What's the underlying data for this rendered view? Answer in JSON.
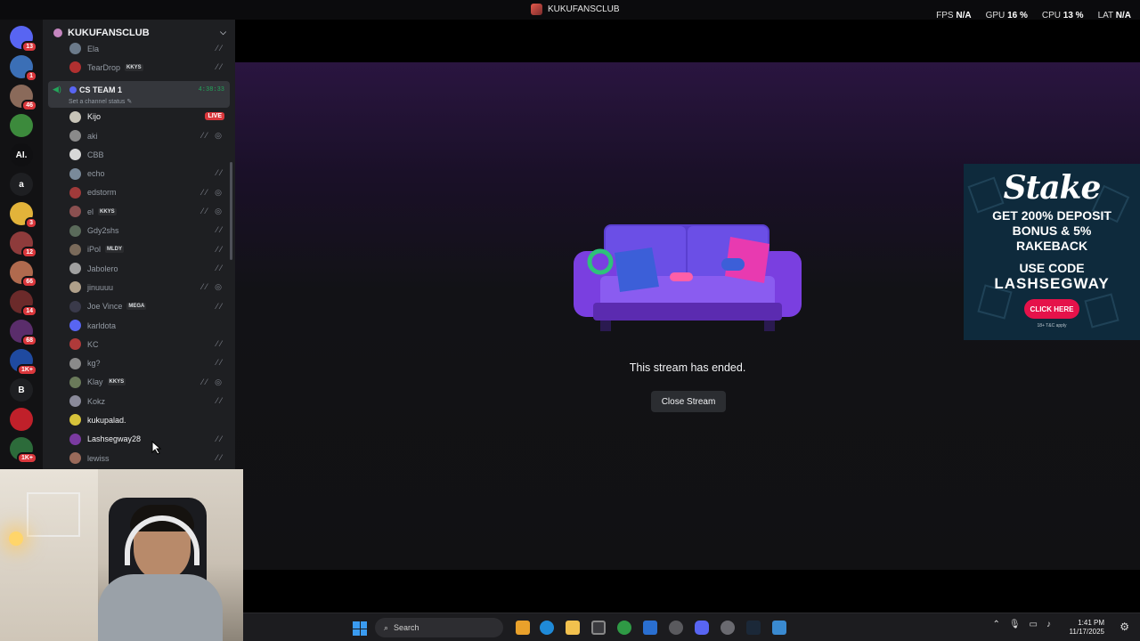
{
  "window": {
    "title": "KUKUFANSCLUB"
  },
  "perf": [
    {
      "label": "FPS",
      "value": "N/A"
    },
    {
      "label": "GPU",
      "value": "16 %"
    },
    {
      "label": "CPU",
      "value": "13 %"
    },
    {
      "label": "LAT",
      "value": "N/A"
    }
  ],
  "guilds": [
    {
      "label": "",
      "color": "#5865f2",
      "badge": "13",
      "icon": "discord-home-icon"
    },
    {
      "label": "",
      "color": "#3b6fb6",
      "badge": "1",
      "icon": "server-icon"
    },
    {
      "label": "",
      "color": "#8a6a5a",
      "badge": "46",
      "icon": "server-icon"
    },
    {
      "label": "",
      "color": "#3c8a3c",
      "badge": "",
      "icon": "server-icon"
    },
    {
      "label": "AI.",
      "color": "#101012",
      "badge": "",
      "icon": "server-icon"
    },
    {
      "label": "a",
      "color": "#1e1f22",
      "badge": "",
      "icon": "server-icon"
    },
    {
      "label": "",
      "color": "#e2b33a",
      "badge": "3",
      "icon": "server-icon"
    },
    {
      "label": "",
      "color": "#8e3b3b",
      "badge": "12",
      "icon": "server-icon"
    },
    {
      "label": "",
      "color": "#b06a4e",
      "badge": "66",
      "icon": "server-icon"
    },
    {
      "label": "",
      "color": "#6b2a2a",
      "badge": "14",
      "icon": "server-icon"
    },
    {
      "label": "",
      "color": "#5a2d6b",
      "badge": "68",
      "icon": "server-icon"
    },
    {
      "label": "",
      "color": "#1f4aa0",
      "badge": "1K+",
      "icon": "server-icon"
    },
    {
      "label": "B",
      "color": "#1e1f22",
      "badge": "",
      "icon": "server-icon"
    },
    {
      "label": "",
      "color": "#c0202a",
      "badge": "",
      "icon": "server-icon"
    },
    {
      "label": "",
      "color": "#2c6b3a",
      "badge": "1K+",
      "icon": "server-icon"
    }
  ],
  "server": {
    "name": "KUKUFANSCLUB"
  },
  "users_above": [
    {
      "name": "Ela",
      "color": "#6b7a8a",
      "tag": "",
      "icons": "⁄⁄"
    },
    {
      "name": "TearDrop",
      "color": "#b03030",
      "tag": "KKYS",
      "icons": "⁄⁄"
    }
  ],
  "voice_channel": {
    "name": "CS TEAM 1",
    "timer": "4:38:33",
    "status": "Set a channel status"
  },
  "users": [
    {
      "name": "Kijo",
      "color": "#c8c4b8",
      "tag": "",
      "icons": "",
      "live": "LIVE",
      "active": true
    },
    {
      "name": "aki",
      "color": "#8a8a8a",
      "tag": "",
      "icons": "⁄⁄ ◎",
      "live": ""
    },
    {
      "name": "CBB",
      "color": "#d8d8d8",
      "tag": "",
      "icons": "",
      "live": ""
    },
    {
      "name": "echo",
      "color": "#7a8a9a",
      "tag": "",
      "icons": "⁄⁄",
      "live": ""
    },
    {
      "name": "edstorm",
      "color": "#a03a3a",
      "tag": "",
      "icons": "⁄⁄ ◎",
      "live": ""
    },
    {
      "name": "el",
      "color": "#8a5050",
      "tag": "KKYS",
      "icons": "⁄⁄ ◎",
      "live": ""
    },
    {
      "name": "Gdy2shs",
      "color": "#5a6a5a",
      "tag": "",
      "icons": "⁄⁄",
      "live": ""
    },
    {
      "name": "iPol",
      "color": "#7a6a5a",
      "tag": "MLDY",
      "icons": "⁄⁄",
      "live": ""
    },
    {
      "name": "Jabolero",
      "color": "#a0a0a0",
      "tag": "",
      "icons": "⁄⁄",
      "live": ""
    },
    {
      "name": "jinuuuu",
      "color": "#b0a08a",
      "tag": "",
      "icons": "⁄⁄ ◎",
      "live": ""
    },
    {
      "name": "Joe Vince",
      "color": "#3a3a4a",
      "tag": "MEGA",
      "icons": "⁄⁄",
      "live": ""
    },
    {
      "name": "karldota",
      "color": "#5865f2",
      "tag": "",
      "icons": "",
      "live": ""
    },
    {
      "name": "KC",
      "color": "#b03a3a",
      "tag": "",
      "icons": "⁄⁄",
      "live": ""
    },
    {
      "name": "kg?",
      "color": "#8a8a8a",
      "tag": "",
      "icons": "⁄⁄",
      "live": ""
    },
    {
      "name": "Klay",
      "color": "#6a7a5a",
      "tag": "KKYS",
      "icons": "⁄⁄ ◎",
      "live": ""
    },
    {
      "name": "Kokz",
      "color": "#8a8a9a",
      "tag": "",
      "icons": "⁄⁄",
      "live": ""
    },
    {
      "name": "kukupalad.",
      "color": "#d6c23a",
      "tag": "",
      "icons": "",
      "live": "",
      "active": true
    },
    {
      "name": "Lashsegway28",
      "color": "#7a3aa0",
      "tag": "",
      "icons": "⁄⁄",
      "live": "",
      "active": true
    },
    {
      "name": "lewiss",
      "color": "#9a6a5a",
      "tag": "",
      "icons": "⁄⁄",
      "live": ""
    }
  ],
  "stream": {
    "message": "This stream has ended.",
    "close_label": "Close Stream"
  },
  "ad": {
    "logo": "Stake",
    "offer_line1": "GET 200% DEPOSIT",
    "offer_line2": "BONUS & 5%",
    "offer_line3": "RAKEBACK",
    "code_label": "USE CODE",
    "code": "LASHSEGWAY",
    "cta": "CLICK HERE",
    "terms": "18+ T&C apply"
  },
  "taskbar": {
    "search_placeholder": "Search",
    "time": "1:41 PM",
    "date": "11/17/2025"
  }
}
